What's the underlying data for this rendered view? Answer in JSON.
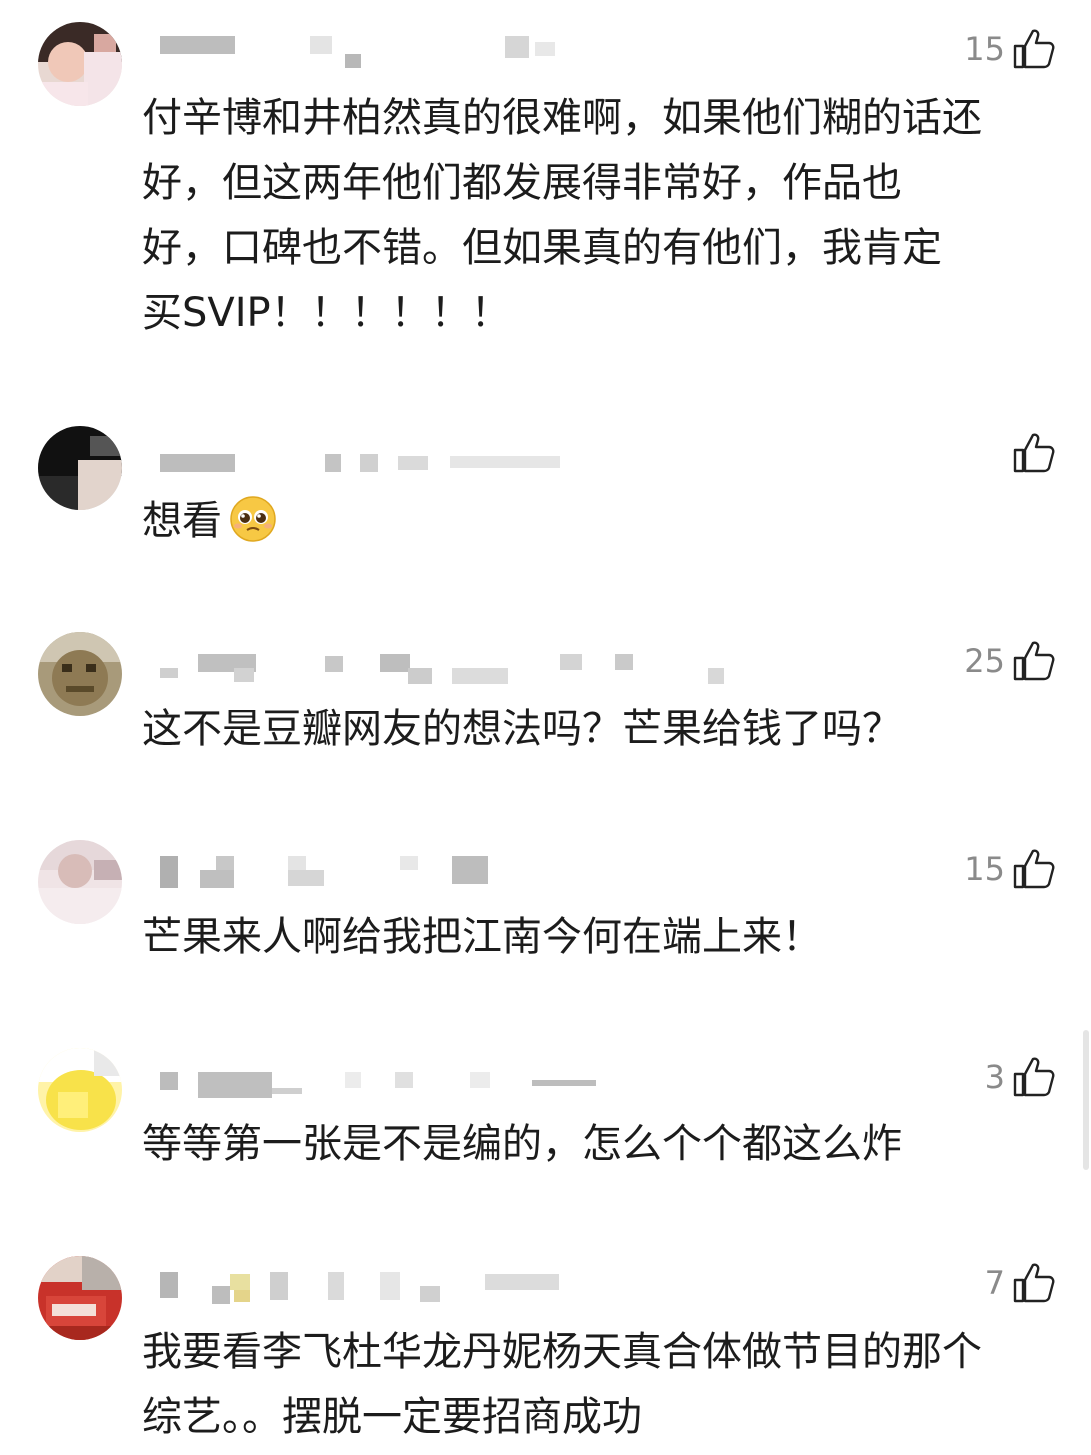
{
  "comments": [
    {
      "likes": "15",
      "text": "付辛博和井柏然真的很难啊，如果他们糊的话还好，但这两年他们都发展得非常好，作品也好，口碑也不错。但如果真的有他们，我肯定买SVIP！！！！！！",
      "lines": [
        "付辛博和井柏然真的很难啊，如果他们糊的话还",
        "好，但这两年他们都发展得非常好，作品也",
        "好，口碑也不错。但如果真的有他们，我肯定",
        "买SVIP！！！！！！"
      ]
    },
    {
      "likes": "",
      "text": "想看",
      "emoji": "pleading-face-emoji"
    },
    {
      "likes": "25",
      "text": "这不是豆瓣网友的想法吗？芒果给钱了吗？"
    },
    {
      "likes": "15",
      "text": "芒果来人啊给我把江南今何在端上来！"
    },
    {
      "likes": "3",
      "text": "等等第一张是不是编的，怎么个个都这么炸"
    },
    {
      "likes": "7",
      "text": "我要看李飞杜华龙丹妮杨天真合体做节目的那个综艺。。摆脱一定要招商成功",
      "lines": [
        "我要看李飞杜华龙丹妮杨天真合体做节目的那个",
        "综艺。。摆脱一定要招商成功"
      ]
    }
  ],
  "icons": {
    "like": "thumbs-up-icon"
  },
  "colors": {
    "text": "#1c1c1c",
    "like_count": "#8a8a8a",
    "censor_block": "#c9c9c9",
    "background": "#ffffff"
  }
}
